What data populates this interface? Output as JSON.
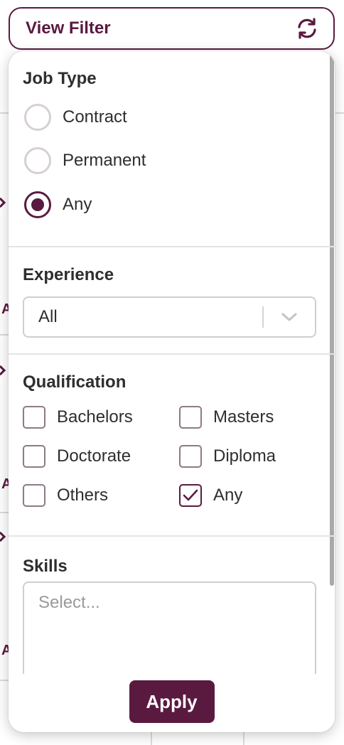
{
  "view_filter": {
    "label": "View Filter",
    "icon": "refresh-icon"
  },
  "job_type": {
    "title": "Job Type",
    "options": [
      {
        "label": "Contract",
        "checked": false
      },
      {
        "label": "Permanent",
        "checked": false
      },
      {
        "label": "Any",
        "checked": true
      }
    ]
  },
  "experience": {
    "title": "Experience",
    "selected": "All"
  },
  "qualification": {
    "title": "Qualification",
    "options": [
      {
        "label": "Bachelors",
        "checked": false
      },
      {
        "label": "Masters",
        "checked": false
      },
      {
        "label": "Doctorate",
        "checked": false
      },
      {
        "label": "Diploma",
        "checked": false
      },
      {
        "label": "Others",
        "checked": false
      },
      {
        "label": "Any",
        "checked": true
      }
    ]
  },
  "skills": {
    "title": "Skills",
    "placeholder": "Select..."
  },
  "apply_label": "Apply",
  "colors": {
    "accent": "#5a1a40"
  }
}
